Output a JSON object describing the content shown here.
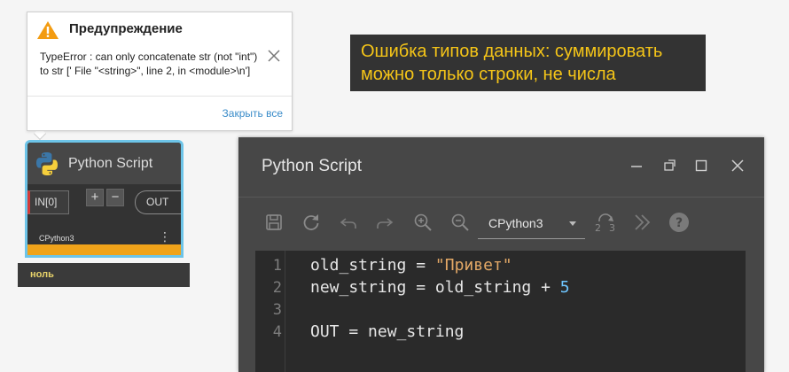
{
  "warning": {
    "title": "Предупреждение",
    "message": "TypeError : can only concatenate str (not \"int\") to str ['  File \"<string>\", line 2, in <module>\\n']",
    "close_all": "Закрыть все",
    "icon": "warning-triangle-icon"
  },
  "annotation": {
    "text": "Ошибка типов данных: суммировать можно только строки, не числа"
  },
  "node": {
    "title": "Python Script",
    "input_port": "IN[0]",
    "add_label": "+",
    "remove_label": "−",
    "output_port": "OUT",
    "engine": "CPython3",
    "menu": "⋮",
    "preview_value": "ноль",
    "state_color": "#f0a31a"
  },
  "editor": {
    "title": "Python Script",
    "engine": "CPython3",
    "lines": [
      {
        "n": "1",
        "a": "old_string = ",
        "b": "\"Привет\"",
        "c": ""
      },
      {
        "n": "2",
        "a": "new_string = old_string + ",
        "b": "",
        "c": "5"
      },
      {
        "n": "3",
        "a": "",
        "b": "",
        "c": ""
      },
      {
        "n": "4",
        "a": "OUT = new_string",
        "b": "",
        "c": ""
      }
    ],
    "toolbar": [
      "save-icon",
      "revert-icon",
      "undo-icon",
      "redo-icon",
      "zoom-in-icon",
      "zoom-out-icon",
      "convert-2to3-icon",
      "more-icon",
      "help-icon"
    ]
  },
  "colors": {
    "selection_border": "#6dc4e8",
    "annotation_text": "#f5c518",
    "error_port": "#d23a3a"
  }
}
